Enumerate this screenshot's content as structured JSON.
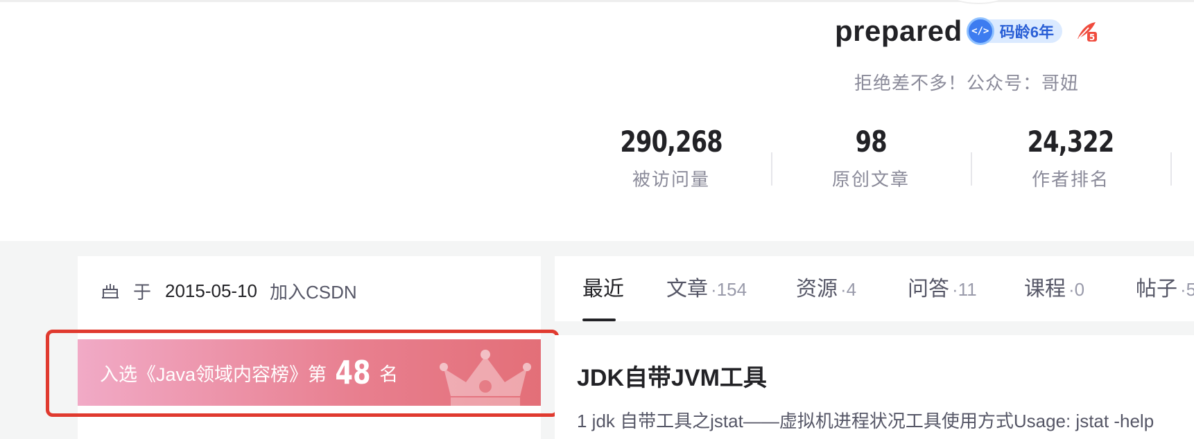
{
  "profile": {
    "username": "prepared",
    "code_age_label": "码龄6年",
    "signature": "拒绝差不多！公众号：哥妞",
    "stats": [
      {
        "value": "290,268",
        "label": "被访问量"
      },
      {
        "value": "98",
        "label": "原创文章"
      },
      {
        "value": "24,322",
        "label": "作者排名"
      }
    ]
  },
  "sidebar": {
    "join_prefix": "于",
    "join_date": "2015-05-10",
    "join_suffix": "加入CSDN",
    "rank_prefix": "入选《Java领域内容榜》第",
    "rank_number": "48",
    "rank_suffix": "名"
  },
  "tabs": [
    {
      "label": "最近",
      "count": ""
    },
    {
      "label": "文章",
      "count": "·154"
    },
    {
      "label": "资源",
      "count": "·4"
    },
    {
      "label": "问答",
      "count": "·11"
    },
    {
      "label": "课程",
      "count": "·0"
    },
    {
      "label": "帖子",
      "count": "·5"
    }
  ],
  "article": {
    "title": "JDK自带JVM工具",
    "summary": "1 jdk 自带工具之jstat——虚拟机进程状况工具使用方式Usage: jstat -help"
  },
  "colors": {
    "highlight": "#e03a2f",
    "banner_start": "#f1aac6",
    "banner_end": "#e36f78",
    "badge_blue": "#3d7cf0"
  },
  "icons": [
    "code-age-icon",
    "feather-icon",
    "cake-icon",
    "crown-icon"
  ]
}
